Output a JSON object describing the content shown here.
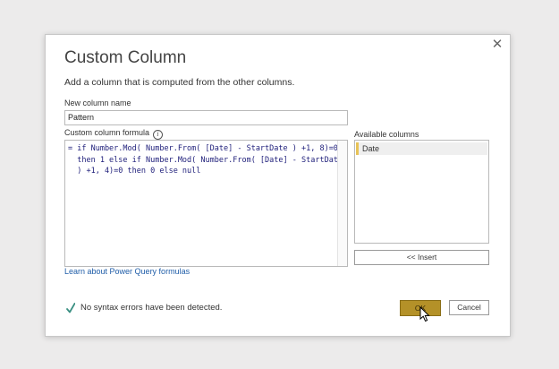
{
  "dialog": {
    "title": "Custom Column",
    "subtitle": "Add a column that is computed from the other columns.",
    "close_label": "✕",
    "new_column_name_label": "New column name",
    "new_column_name_value": "Pattern",
    "formula_label": "Custom column formula",
    "formula_lines": [
      "= if Number.Mod( Number.From( [Date] - StartDate ) +1, 8)=0",
      "  then 1 else if Number.Mod( Number.From( [Date] - StartDate",
      "  ) +1, 4)=0 then 0 else null"
    ],
    "available_columns_label": "Available columns",
    "available_columns": [
      "Date"
    ],
    "insert_button": "<< Insert",
    "learn_link": "Learn about Power Query formulas",
    "status_text": "No syntax errors have been detected.",
    "ok_button": "OK",
    "cancel_button": "Cancel"
  },
  "colors": {
    "accent": "#b49128",
    "column_marker": "#e8c357",
    "link": "#1f5da8",
    "check": "#3a8f82"
  },
  "icons": [
    "close-icon",
    "info-icon",
    "check-icon",
    "mouse-cursor-icon"
  ]
}
